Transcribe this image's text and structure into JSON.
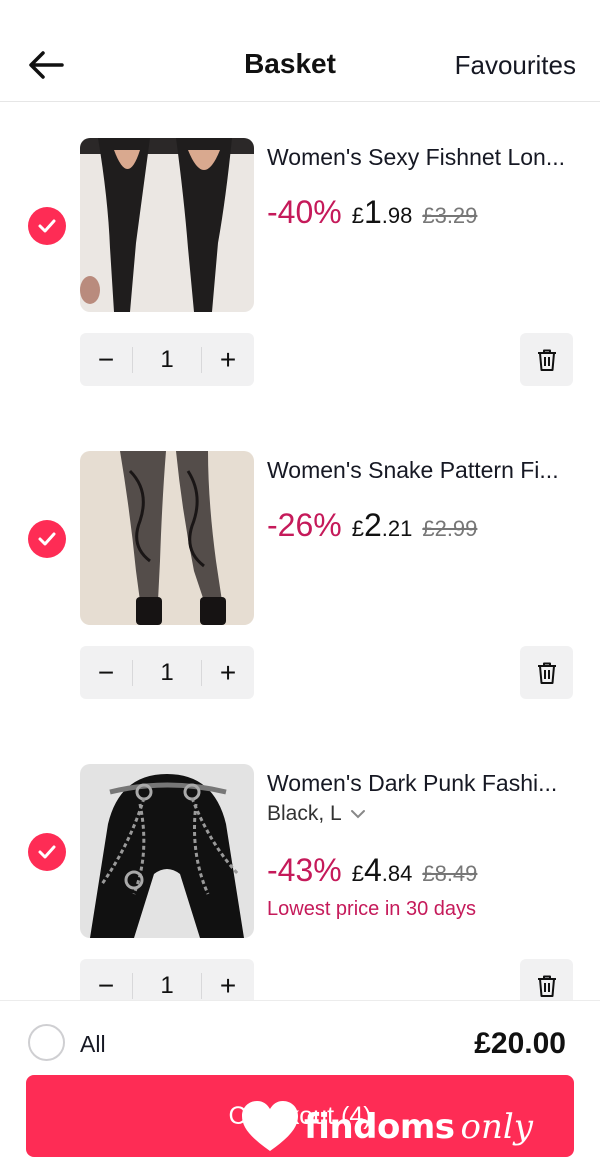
{
  "header": {
    "title": "Basket",
    "favourites": "Favourites"
  },
  "items": [
    {
      "name": "Women's Sexy Fishnet Lon...",
      "variant": "",
      "discount": "-40%",
      "price_currency": "£",
      "price_major": "1",
      "price_minor": ".98",
      "old_price": "£3.29",
      "note": "",
      "quantity": "1",
      "checked": true
    },
    {
      "name": "Women's Snake Pattern Fi...",
      "variant": "",
      "discount": "-26%",
      "price_currency": "£",
      "price_major": "2",
      "price_minor": ".21",
      "old_price": "£2.99",
      "note": "",
      "quantity": "1",
      "checked": true
    },
    {
      "name": "Women's Dark Punk Fashi...",
      "variant": "Black, L",
      "discount": "-43%",
      "price_currency": "£",
      "price_major": "4",
      "price_minor": ".84",
      "old_price": "£8.49",
      "note": "Lowest price in 30 days",
      "quantity": "1",
      "checked": true
    }
  ],
  "stepper": {
    "minus": "−",
    "plus": "+"
  },
  "footer": {
    "all_label": "All",
    "total": "£20.00",
    "checkout_label": "Checkout (4)"
  },
  "watermark": {
    "text_a": "findoms",
    "text_b": "only"
  },
  "colors": {
    "accent": "#fe2c55",
    "discount": "#c51a5a",
    "stepper_bg": "#f1f1f2"
  }
}
